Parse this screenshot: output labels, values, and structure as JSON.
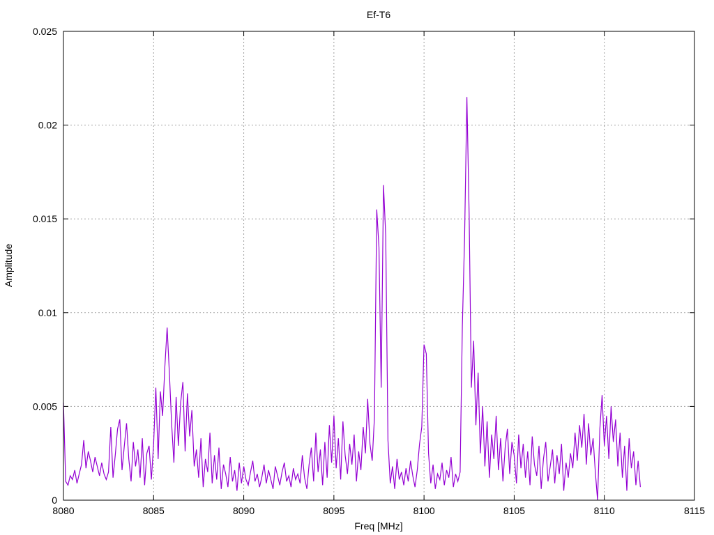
{
  "chart_data": {
    "type": "line",
    "title": "Ef-T6",
    "xlabel": "Freq [MHz]",
    "ylabel": "Amplitude",
    "xlim": [
      8080,
      8115
    ],
    "ylim": [
      0,
      0.025
    ],
    "grid": true,
    "legend": "none",
    "line_color": "#9400d3",
    "x_ticks": [
      "8080",
      "8085",
      "8090",
      "8095",
      "8100",
      "8105",
      "8110",
      "8115"
    ],
    "x_tick_values": [
      8080,
      8085,
      8090,
      8095,
      8100,
      8105,
      8110,
      8115
    ],
    "y_ticks": [
      "0",
      "0.005",
      "0.01",
      "0.015",
      "0.02",
      "0.025"
    ],
    "y_tick_values": [
      0,
      0.005,
      0.01,
      0.015,
      0.02,
      0.025
    ],
    "series": [
      {
        "name": "Ef-T6",
        "x_start": 8080,
        "x_step": 0.125,
        "values": [
          0.0052,
          0.001,
          0.0008,
          0.0013,
          0.0011,
          0.0016,
          0.0009,
          0.0014,
          0.0019,
          0.0032,
          0.0017,
          0.0026,
          0.0021,
          0.0015,
          0.0023,
          0.0018,
          0.0013,
          0.002,
          0.0014,
          0.0011,
          0.0015,
          0.0039,
          0.0012,
          0.0024,
          0.0038,
          0.0043,
          0.0016,
          0.0029,
          0.0041,
          0.0022,
          0.001,
          0.0031,
          0.0018,
          0.0027,
          0.0012,
          0.0033,
          0.0008,
          0.0025,
          0.0029,
          0.0011,
          0.003,
          0.006,
          0.0022,
          0.0058,
          0.0045,
          0.0071,
          0.0092,
          0.0068,
          0.0041,
          0.002,
          0.0055,
          0.0029,
          0.0052,
          0.0063,
          0.0026,
          0.0057,
          0.0034,
          0.0048,
          0.0018,
          0.0027,
          0.0012,
          0.0033,
          0.0007,
          0.0022,
          0.0015,
          0.0036,
          0.0009,
          0.0024,
          0.0011,
          0.0028,
          0.0006,
          0.0019,
          0.0014,
          0.0007,
          0.0023,
          0.001,
          0.0016,
          0.0005,
          0.002,
          0.0009,
          0.0018,
          0.0011,
          0.0008,
          0.0015,
          0.0021,
          0.001,
          0.0014,
          0.0007,
          0.0012,
          0.0019,
          0.0009,
          0.0016,
          0.0011,
          0.0006,
          0.0018,
          0.0013,
          0.0008,
          0.0015,
          0.002,
          0.001,
          0.0013,
          0.0007,
          0.0017,
          0.0011,
          0.0014,
          0.0009,
          0.0024,
          0.0012,
          0.0006,
          0.0019,
          0.0028,
          0.001,
          0.0036,
          0.0015,
          0.0027,
          0.0008,
          0.0031,
          0.0012,
          0.004,
          0.002,
          0.0045,
          0.0017,
          0.0033,
          0.0011,
          0.0042,
          0.0024,
          0.0014,
          0.003,
          0.0019,
          0.0035,
          0.001,
          0.0026,
          0.0016,
          0.0039,
          0.0025,
          0.0054,
          0.003,
          0.0021,
          0.0044,
          0.0155,
          0.0135,
          0.006,
          0.0168,
          0.0141,
          0.0032,
          0.0009,
          0.0018,
          0.0006,
          0.0022,
          0.0011,
          0.0015,
          0.0008,
          0.0017,
          0.001,
          0.0021,
          0.0013,
          0.0007,
          0.0016,
          0.003,
          0.0039,
          0.0083,
          0.0078,
          0.0025,
          0.0009,
          0.0019,
          0.0006,
          0.0014,
          0.0011,
          0.002,
          0.0008,
          0.0016,
          0.0012,
          0.0023,
          0.0007,
          0.0014,
          0.001,
          0.0015,
          0.0093,
          0.014,
          0.0215,
          0.0153,
          0.006,
          0.0085,
          0.004,
          0.0068,
          0.0025,
          0.005,
          0.0018,
          0.0042,
          0.0012,
          0.0035,
          0.0022,
          0.0045,
          0.0016,
          0.0033,
          0.001,
          0.0028,
          0.0038,
          0.0014,
          0.0031,
          0.0024,
          0.0009,
          0.0035,
          0.0017,
          0.003,
          0.0012,
          0.0026,
          0.0008,
          0.0034,
          0.0019,
          0.0013,
          0.0029,
          0.0006,
          0.0022,
          0.0031,
          0.001,
          0.0018,
          0.0027,
          0.0009,
          0.0024,
          0.0014,
          0.003,
          0.0005,
          0.002,
          0.0012,
          0.0025,
          0.0017,
          0.0036,
          0.0021,
          0.004,
          0.0028,
          0.0046,
          0.0019,
          0.0041,
          0.0024,
          0.0033,
          0.0015,
          0.0,
          0.0038,
          0.0056,
          0.0029,
          0.0045,
          0.0022,
          0.005,
          0.0031,
          0.0043,
          0.0018,
          0.0036,
          0.0012,
          0.0029,
          0.0005,
          0.0033,
          0.0017,
          0.0026,
          0.0008,
          0.0021,
          0.0007
        ]
      }
    ]
  }
}
